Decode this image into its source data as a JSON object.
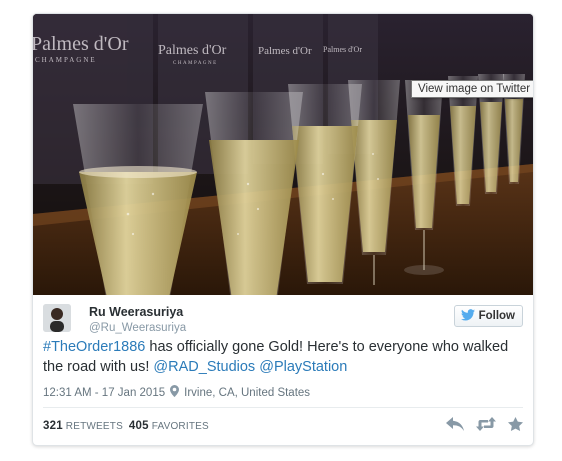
{
  "media": {
    "tooltip": "View image on Twitter",
    "wall_text": [
      "Palmes d'Or",
      "Palmes d'Or",
      "Palmes d'Or",
      "Palmes d'Or"
    ],
    "wall_subtext": "CHAMPAGNE"
  },
  "tweet": {
    "author_name": "Ru Weerasuriya",
    "author_handle": "@Ru_Weerasuriya",
    "follow_label": "Follow",
    "text": {
      "hashtag": "#TheOrder1886",
      "body": " has officially gone Gold! Here's to everyone who walked the road with us! ",
      "mention1": "@RAD_Studios",
      "mention2": "@PlayStation"
    },
    "timestamp": "12:31 AM - 17 Jan 2015",
    "location": "Irvine, CA, United States",
    "retweets_count": "321",
    "retweets_label": "RETWEETS",
    "favorites_count": "405",
    "favorites_label": "FAVORITES"
  },
  "colors": {
    "link": "#2b7bb9",
    "twitter_bird": "#55acee",
    "muted": "#66757f"
  },
  "icons": [
    "twitter-bird-icon",
    "location-pin-icon",
    "reply-icon",
    "retweet-icon",
    "favorite-star-icon"
  ]
}
